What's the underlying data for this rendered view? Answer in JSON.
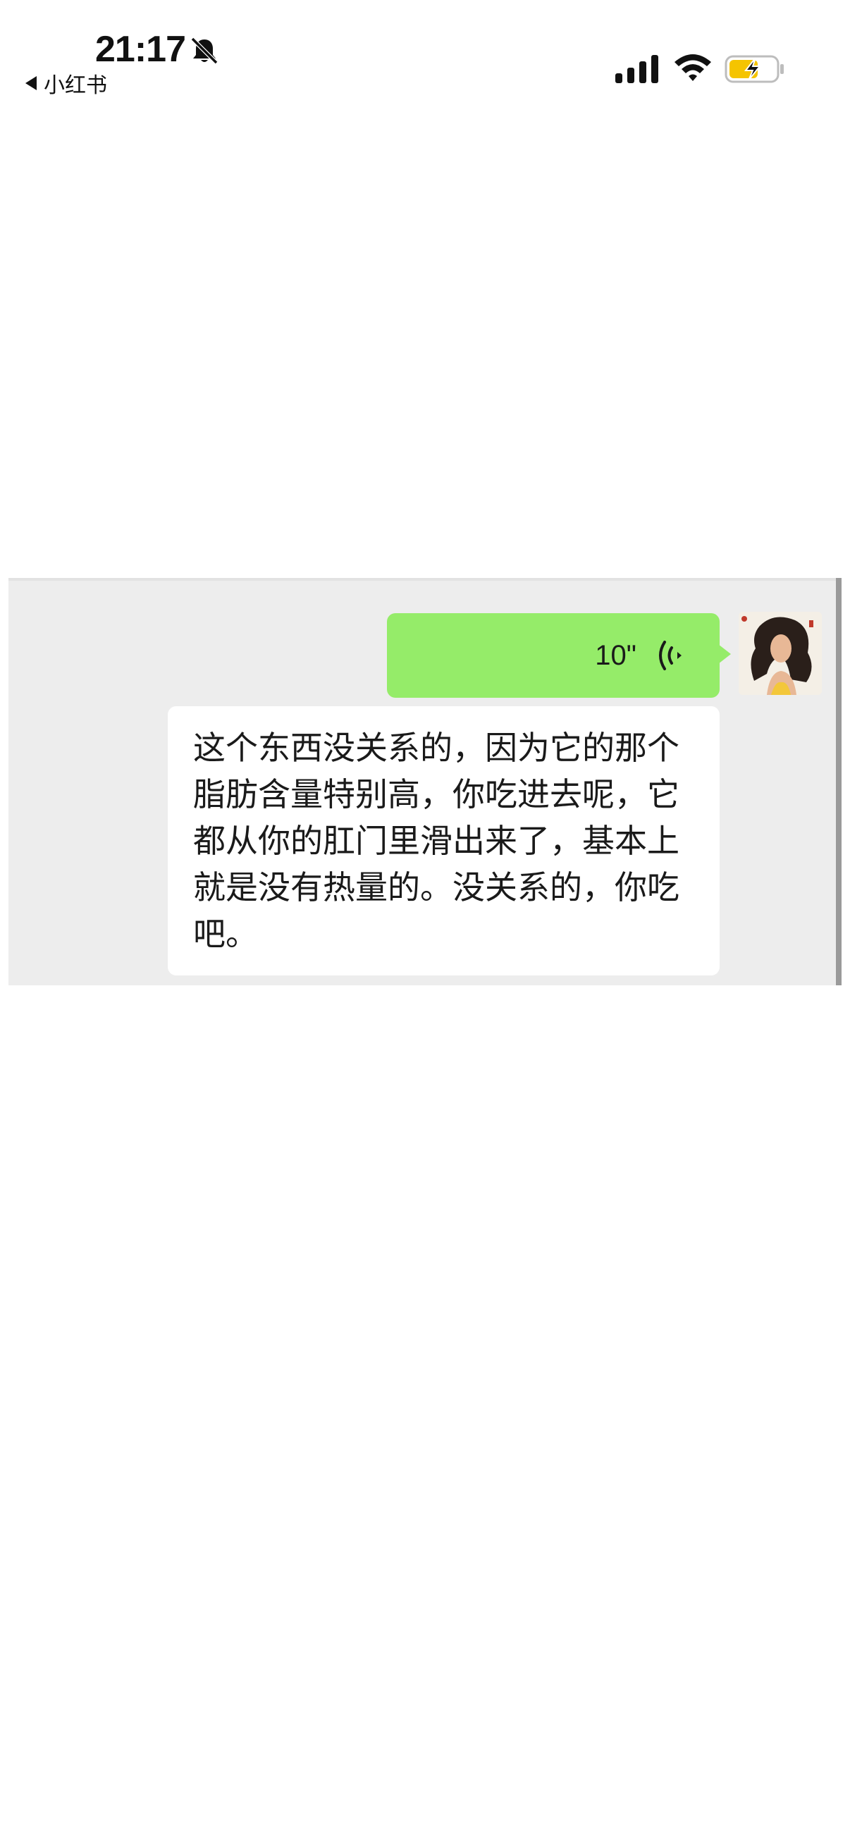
{
  "status_bar": {
    "time": "21:17",
    "back_label": "小红书",
    "icons": [
      "bell-off-icon",
      "signal-icon",
      "wifi-icon",
      "battery-charging-icon"
    ],
    "battery_color": "#f5c400"
  },
  "chat": {
    "voice_message": {
      "duration": "10\"",
      "bubble_color": "#95ec69"
    },
    "transcript": {
      "text": "这个东西没关系的，因为它的那个脂肪含量特别高，你吃进去呢，它都从你的肛门里滑出来了，基本上就是没有热量的。没关系的，你吃吧。"
    },
    "background_color": "#ededed"
  }
}
